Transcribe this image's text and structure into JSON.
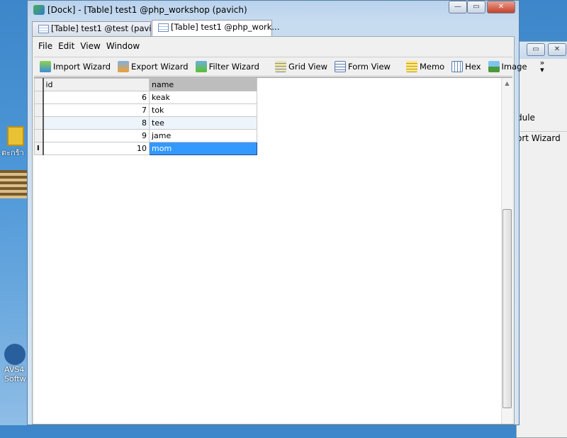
{
  "window": {
    "title": "[Dock] - [Table] test1 @php_workshop (pavich)"
  },
  "tabs": [
    {
      "label": "[Table] test1 @test (pavi..."
    },
    {
      "label": "[Table] test1 @php_work..."
    }
  ],
  "menu": [
    "File",
    "Edit",
    "View",
    "Window"
  ],
  "toolbar": {
    "import": "Import Wizard",
    "export": "Export Wizard",
    "filter": "Filter Wizard",
    "grid": "Grid View",
    "form": "Form View",
    "memo": "Memo",
    "hex": "Hex",
    "image": "Image",
    "more": "»"
  },
  "grid": {
    "columns": [
      "id",
      "name"
    ],
    "rows": [
      {
        "id": "6",
        "name": "keak"
      },
      {
        "id": "7",
        "name": "tok"
      },
      {
        "id": "8",
        "name": "tee"
      },
      {
        "id": "9",
        "name": "jame"
      },
      {
        "id": "10",
        "name": "mom"
      }
    ],
    "cursor": "I"
  },
  "background_window": {
    "label1": "dule",
    "label2": "ort Wizard"
  },
  "desktop": {
    "icon1": "ตะกร้า",
    "icon2a": "AVS4",
    "icon2b": "Softw"
  }
}
